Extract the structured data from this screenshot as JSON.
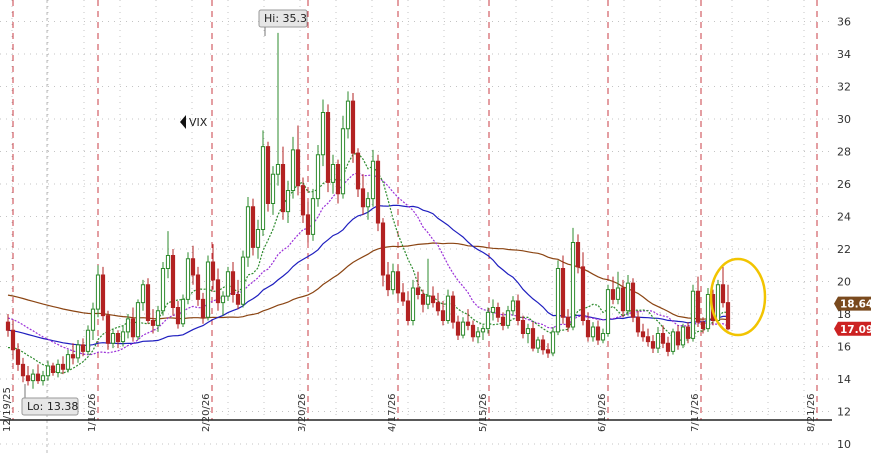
{
  "chart_data": {
    "type": "candlestick",
    "symbol": "VIX",
    "ylim": [
      10,
      37
    ],
    "y_ticks": [
      10,
      12,
      14,
      16,
      18,
      20,
      22,
      24,
      26,
      28,
      30,
      32,
      34,
      36
    ],
    "x_tick_labels": [
      "12/19/25",
      "1/16/26",
      "2/20/26",
      "3/20/26",
      "4/17/26",
      "5/15/26",
      "6/19/26",
      "7/17/26",
      "8/21/26"
    ],
    "hi_label": "Hi: 35.3",
    "lo_label": "Lo: 13.38",
    "last_price_tags": [
      {
        "text": "18.64",
        "value": 18.64,
        "color": "#7a4a1e"
      },
      {
        "text": "17.09",
        "value": 17.09,
        "color": "#cc2222"
      }
    ],
    "grid": true,
    "colors": {
      "up": "#2e8b2e",
      "down": "#b22222",
      "sma_short": "#2e8b2e",
      "sma_mid": "#9b30d9",
      "sma_blue": "#1f1fbf",
      "sma_long": "#8b4513",
      "highlight": "#f2c400",
      "month_divider": "#c83c46"
    },
    "candles": [
      [
        17.5,
        18.0,
        16.6,
        17.0
      ],
      [
        17.0,
        17.6,
        15.2,
        15.8
      ],
      [
        15.8,
        16.2,
        14.5,
        14.9
      ],
      [
        14.9,
        15.3,
        13.8,
        14.2
      ],
      [
        14.2,
        14.8,
        13.6,
        13.9
      ],
      [
        13.9,
        14.6,
        13.4,
        14.3
      ],
      [
        14.3,
        14.9,
        13.7,
        13.9
      ],
      [
        13.9,
        14.5,
        13.6,
        14.2
      ],
      [
        14.2,
        15.1,
        13.9,
        14.8
      ],
      [
        14.8,
        15.0,
        14.2,
        14.4
      ],
      [
        14.4,
        15.2,
        14.1,
        14.9
      ],
      [
        14.9,
        15.4,
        14.3,
        14.6
      ],
      [
        14.6,
        15.8,
        14.4,
        15.5
      ],
      [
        15.5,
        16.2,
        14.9,
        15.3
      ],
      [
        15.3,
        16.4,
        15.0,
        16.1
      ],
      [
        16.1,
        16.5,
        15.4,
        15.7
      ],
      [
        15.7,
        17.3,
        15.5,
        17.0
      ],
      [
        17.0,
        18.7,
        16.4,
        18.3
      ],
      [
        18.3,
        21.0,
        17.8,
        20.4
      ],
      [
        20.4,
        20.9,
        17.6,
        17.9
      ],
      [
        17.9,
        18.2,
        15.8,
        16.2
      ],
      [
        16.2,
        17.1,
        15.9,
        16.8
      ],
      [
        16.8,
        17.0,
        15.9,
        16.3
      ],
      [
        16.3,
        17.3,
        16.0,
        16.9
      ],
      [
        16.9,
        18.0,
        16.5,
        17.7
      ],
      [
        17.7,
        18.4,
        16.3,
        16.6
      ],
      [
        16.6,
        18.9,
        16.4,
        18.7
      ],
      [
        18.7,
        20.1,
        18.2,
        19.8
      ],
      [
        19.8,
        20.2,
        17.4,
        17.6
      ],
      [
        17.6,
        18.3,
        16.8,
        17.3
      ],
      [
        17.3,
        18.5,
        16.9,
        18.2
      ],
      [
        18.2,
        21.2,
        17.9,
        20.8
      ],
      [
        20.8,
        23.1,
        20.2,
        21.6
      ],
      [
        21.6,
        22.0,
        17.9,
        18.4
      ],
      [
        18.4,
        18.8,
        17.1,
        17.4
      ],
      [
        17.4,
        19.2,
        17.2,
        18.9
      ],
      [
        18.9,
        21.8,
        18.6,
        21.4
      ],
      [
        21.4,
        22.2,
        19.8,
        20.4
      ],
      [
        20.4,
        20.9,
        18.5,
        18.9
      ],
      [
        18.9,
        19.3,
        17.4,
        17.8
      ],
      [
        17.8,
        21.6,
        17.6,
        21.2
      ],
      [
        21.2,
        22.3,
        19.5,
        20.1
      ],
      [
        20.1,
        20.8,
        18.2,
        18.7
      ],
      [
        18.7,
        19.4,
        17.9,
        19.1
      ],
      [
        19.1,
        20.9,
        18.8,
        20.6
      ],
      [
        20.6,
        21.2,
        18.7,
        19.2
      ],
      [
        19.2,
        20.1,
        18.3,
        18.6
      ],
      [
        18.6,
        21.9,
        18.4,
        21.5
      ],
      [
        21.5,
        25.2,
        20.9,
        24.6
      ],
      [
        24.6,
        25.1,
        21.6,
        22.1
      ],
      [
        22.1,
        23.8,
        21.4,
        23.2
      ],
      [
        23.2,
        29.3,
        22.8,
        28.3
      ],
      [
        28.3,
        28.6,
        24.3,
        24.8
      ],
      [
        24.8,
        27.1,
        24.1,
        26.6
      ],
      [
        26.6,
        35.3,
        25.9,
        27.2
      ],
      [
        27.2,
        28.3,
        23.8,
        24.3
      ],
      [
        24.3,
        26.2,
        23.6,
        25.6
      ],
      [
        25.6,
        28.9,
        25.1,
        28.1
      ],
      [
        28.1,
        29.6,
        25.3,
        25.9
      ],
      [
        25.9,
        26.4,
        23.6,
        24.1
      ],
      [
        24.1,
        24.9,
        22.4,
        22.9
      ],
      [
        22.9,
        25.7,
        22.5,
        25.1
      ],
      [
        25.1,
        28.4,
        24.6,
        27.8
      ],
      [
        27.8,
        31.2,
        27.1,
        30.4
      ],
      [
        30.4,
        30.9,
        25.5,
        26.1
      ],
      [
        26.1,
        27.8,
        25.4,
        27.2
      ],
      [
        27.2,
        27.5,
        24.8,
        25.4
      ],
      [
        25.4,
        30.2,
        25.1,
        29.4
      ],
      [
        29.4,
        31.7,
        28.8,
        31.1
      ],
      [
        31.1,
        31.6,
        27.3,
        27.9
      ],
      [
        27.9,
        28.2,
        25.2,
        25.7
      ],
      [
        25.7,
        26.6,
        24.1,
        24.6
      ],
      [
        24.6,
        25.5,
        23.8,
        25.1
      ],
      [
        25.1,
        28.1,
        24.6,
        27.4
      ],
      [
        27.4,
        27.8,
        23.1,
        23.6
      ],
      [
        23.6,
        23.9,
        19.7,
        20.4
      ],
      [
        20.4,
        21.2,
        19.1,
        19.5
      ],
      [
        19.5,
        21.1,
        19.2,
        20.6
      ],
      [
        20.6,
        21.0,
        18.8,
        19.3
      ],
      [
        19.3,
        19.9,
        18.5,
        18.8
      ],
      [
        18.8,
        19.4,
        17.3,
        17.6
      ],
      [
        17.6,
        20.1,
        17.3,
        19.6
      ],
      [
        19.6,
        20.6,
        18.9,
        19.2
      ],
      [
        19.2,
        19.5,
        18.1,
        18.6
      ],
      [
        18.6,
        21.4,
        18.3,
        19.1
      ],
      [
        19.1,
        19.7,
        18.4,
        18.7
      ],
      [
        18.7,
        19.3,
        17.9,
        18.2
      ],
      [
        18.2,
        18.8,
        17.3,
        17.6
      ],
      [
        17.6,
        19.5,
        17.4,
        19.1
      ],
      [
        19.1,
        19.4,
        17.1,
        17.5
      ],
      [
        17.5,
        17.9,
        16.4,
        16.7
      ],
      [
        16.7,
        17.8,
        16.5,
        17.5
      ],
      [
        17.5,
        18.3,
        17.0,
        17.3
      ],
      [
        17.3,
        17.6,
        16.3,
        16.6
      ],
      [
        16.6,
        17.2,
        16.2,
        16.9
      ],
      [
        16.9,
        17.3,
        16.4,
        17.1
      ],
      [
        17.1,
        18.4,
        16.8,
        18.1
      ],
      [
        18.1,
        18.9,
        17.6,
        18.4
      ],
      [
        18.4,
        18.7,
        17.5,
        17.8
      ],
      [
        17.8,
        18.1,
        17.0,
        17.3
      ],
      [
        17.3,
        18.5,
        17.1,
        18.2
      ],
      [
        18.2,
        19.1,
        17.9,
        18.8
      ],
      [
        18.8,
        19.2,
        17.3,
        17.6
      ],
      [
        17.6,
        17.9,
        16.5,
        16.8
      ],
      [
        16.8,
        17.4,
        16.2,
        17.1
      ],
      [
        17.1,
        17.5,
        15.7,
        15.9
      ],
      [
        15.9,
        16.6,
        15.6,
        16.4
      ],
      [
        16.4,
        16.7,
        15.5,
        15.8
      ],
      [
        15.8,
        16.2,
        15.3,
        15.6
      ],
      [
        15.6,
        17.2,
        15.4,
        16.9
      ],
      [
        16.9,
        21.3,
        16.7,
        20.8
      ],
      [
        20.8,
        21.6,
        17.4,
        17.8
      ],
      [
        17.8,
        18.3,
        16.9,
        17.2
      ],
      [
        17.2,
        23.3,
        17.0,
        22.4
      ],
      [
        22.4,
        22.9,
        20.5,
        20.9
      ],
      [
        20.9,
        21.8,
        17.3,
        17.6
      ],
      [
        17.6,
        18.1,
        16.3,
        16.6
      ],
      [
        16.6,
        17.5,
        16.3,
        17.2
      ],
      [
        17.2,
        17.6,
        16.1,
        16.4
      ],
      [
        16.4,
        17.1,
        16.2,
        16.8
      ],
      [
        16.8,
        19.8,
        16.6,
        19.5
      ],
      [
        19.5,
        20.3,
        18.6,
        18.9
      ],
      [
        18.9,
        20.6,
        18.6,
        19.6
      ],
      [
        19.6,
        20.1,
        17.8,
        18.2
      ],
      [
        18.2,
        20.4,
        17.9,
        19.9
      ],
      [
        19.9,
        20.2,
        17.5,
        17.8
      ],
      [
        17.8,
        18.2,
        16.6,
        16.9
      ],
      [
        16.9,
        17.4,
        16.3,
        16.6
      ],
      [
        16.6,
        17.1,
        16.0,
        16.3
      ],
      [
        16.3,
        16.7,
        15.6,
        15.9
      ],
      [
        15.9,
        17.2,
        15.6,
        16.8
      ],
      [
        16.8,
        17.3,
        15.9,
        16.2
      ],
      [
        16.2,
        16.6,
        15.4,
        15.7
      ],
      [
        15.7,
        17.1,
        15.5,
        16.9
      ],
      [
        16.9,
        17.3,
        15.8,
        16.1
      ],
      [
        16.1,
        17.4,
        15.9,
        17.2
      ],
      [
        17.2,
        17.5,
        16.2,
        16.5
      ],
      [
        16.5,
        19.8,
        16.3,
        19.4
      ],
      [
        19.4,
        20.3,
        17.2,
        17.5
      ],
      [
        17.5,
        17.8,
        16.8,
        17.1
      ],
      [
        17.1,
        19.6,
        16.9,
        19.2
      ],
      [
        19.2,
        19.5,
        17.3,
        17.6
      ],
      [
        17.6,
        20.1,
        17.4,
        19.8
      ],
      [
        19.8,
        20.9,
        18.4,
        18.7
      ],
      [
        18.7,
        19.8,
        17.0,
        17.09
      ]
    ]
  }
}
